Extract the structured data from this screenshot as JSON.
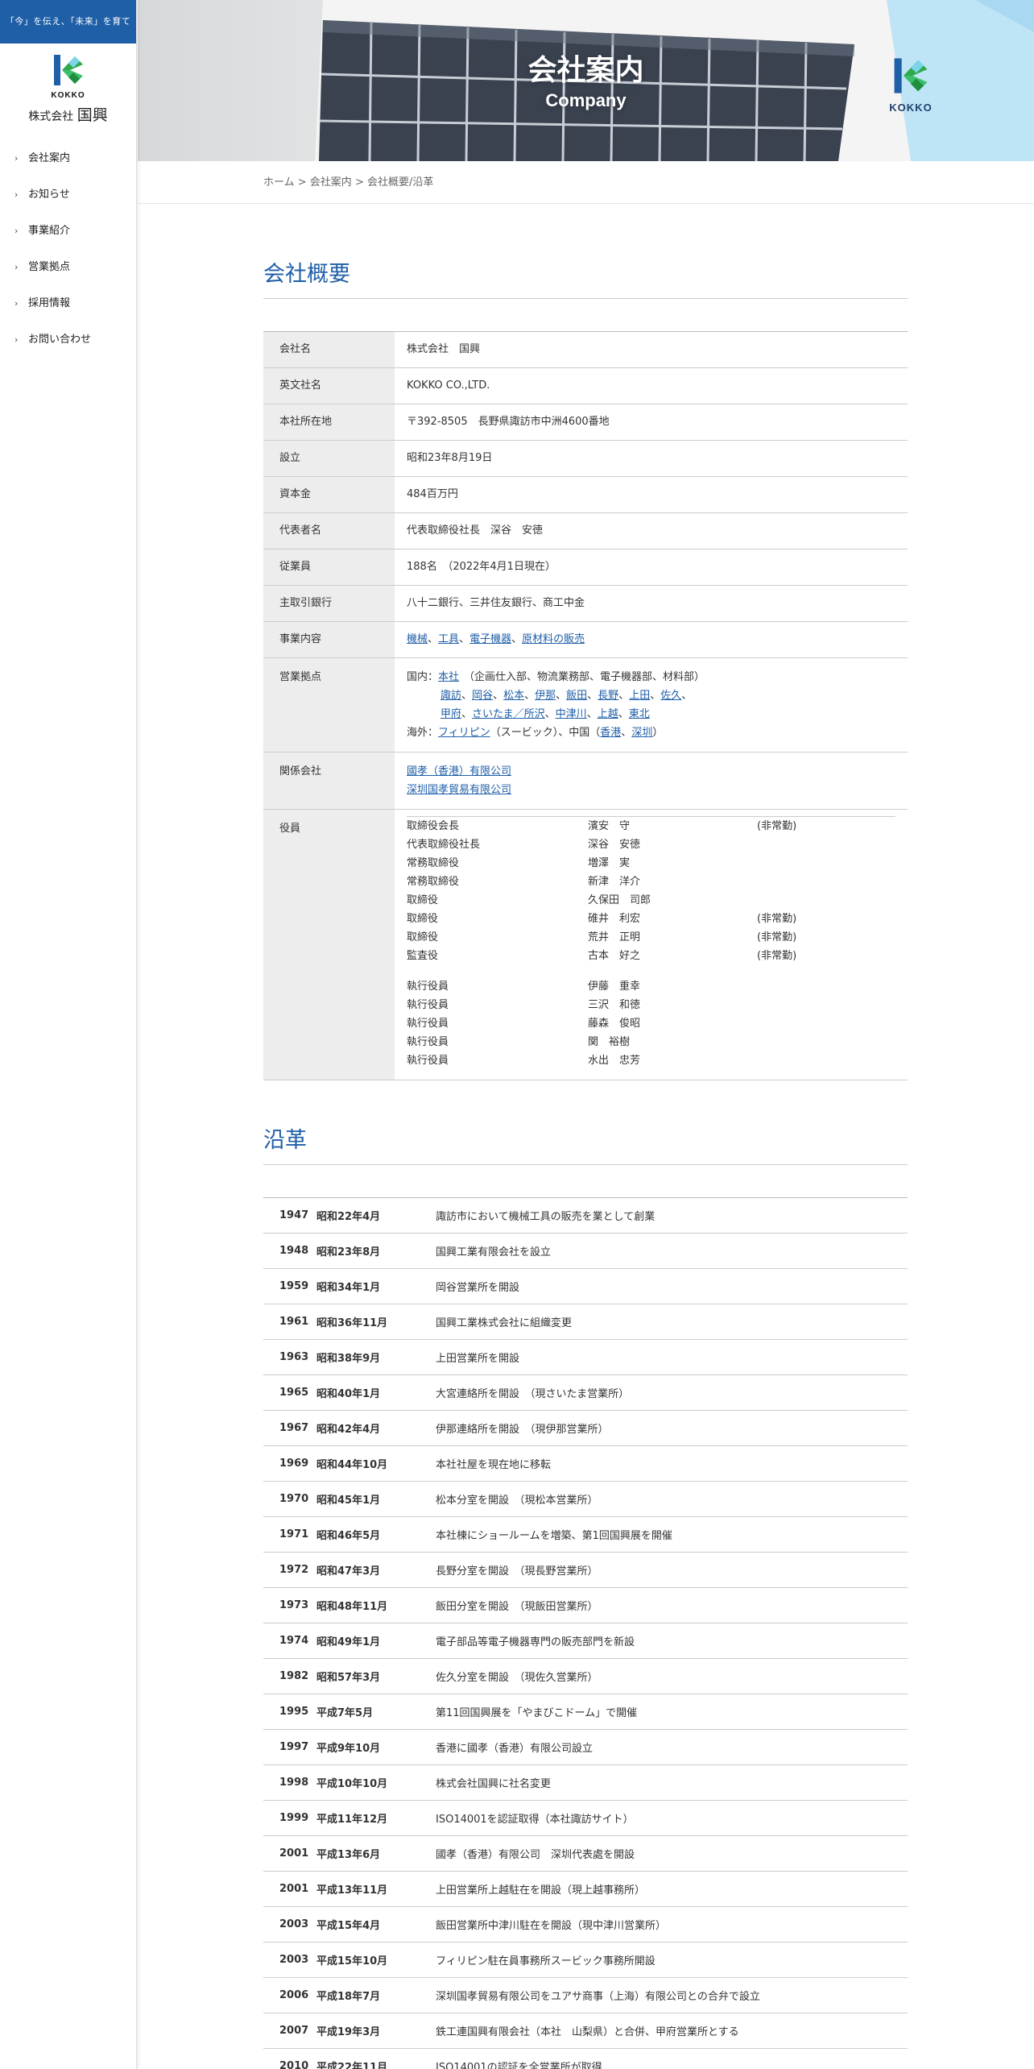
{
  "sidebar": {
    "tagline": "「今」を伝え、「未来」を育てる。",
    "logo_word": "KOKKO",
    "logo_company_prefix": "株式会社",
    "logo_company_name": "国興",
    "nav": [
      {
        "label": "会社案内"
      },
      {
        "label": "お知らせ"
      },
      {
        "label": "事業紹介"
      },
      {
        "label": "営業拠点"
      },
      {
        "label": "採用情報"
      },
      {
        "label": "お問い合わせ"
      }
    ]
  },
  "hero": {
    "title": "会社案内",
    "subtitle": "Company",
    "building_logo": "KOKKO"
  },
  "breadcrumb": {
    "home": "ホーム",
    "sep": " > ",
    "company": "会社案内",
    "current": "会社概要/沿革"
  },
  "overview": {
    "heading": "会社概要",
    "rows": {
      "name_k": "会社名",
      "name_v": "株式会社　国興",
      "en_k": "英文社名",
      "en_v": "KOKKO CO.,LTD.",
      "addr_k": "本社所在地",
      "addr_v": "〒392-8505　長野県諏訪市中洲4600番地",
      "est_k": "設立",
      "est_v": "昭和23年8月19日",
      "cap_k": "資本金",
      "cap_v": "484百万円",
      "rep_k": "代表者名",
      "rep_v": "代表取締役社長　深谷　安徳",
      "emp_k": "従業員",
      "emp_v": "188名　（2022年4月1日現在）",
      "bank_k": "主取引銀行",
      "bank_v": "八十二銀行、三井住友銀行、商工中金",
      "biz_k": "事業内容",
      "biz_links": [
        "機械",
        "工具",
        "電子機器",
        "原材料の販売"
      ],
      "sep_comma": "、",
      "office_k": "営業拠点",
      "office_dom_prefix": "国内：",
      "office_hq": "本社",
      "office_hq_note": "（企画仕入部、物流業務部、電子機器部、材料部）",
      "office_dom_line2": [
        "諏訪",
        "岡谷",
        "松本",
        "伊那",
        "飯田",
        "長野",
        "上田",
        "佐久"
      ],
      "office_dom_line3": [
        "甲府",
        "さいたま／所沢",
        "中津川",
        "上越",
        "東北"
      ],
      "office_ovs_prefix": "海外：",
      "office_ph": "フィリピン",
      "office_ph_note": "（スービック）、中国（",
      "office_hk": "香港",
      "office_sz": "深圳",
      "office_close": "）",
      "aff_k": "関係会社",
      "aff_links": [
        "國孝（香港）有限公司",
        "深圳国孝貿易有限公司"
      ],
      "off_k": "役員"
    },
    "officers": [
      {
        "title": "取締役会長",
        "name": "濱安　守",
        "note": "(非常勤)"
      },
      {
        "title": "代表取締役社長",
        "name": "深谷　安徳",
        "note": ""
      },
      {
        "title": "常務取締役",
        "name": "増澤　実",
        "note": ""
      },
      {
        "title": "常務取締役",
        "name": "新津　洋介",
        "note": ""
      },
      {
        "title": "取締役",
        "name": "久保田　司郎",
        "note": ""
      },
      {
        "title": "取締役",
        "name": "碓井　利宏",
        "note": "(非常勤)"
      },
      {
        "title": "取締役",
        "name": "荒井　正明",
        "note": "(非常勤)"
      },
      {
        "title": "監査役",
        "name": "古本　好之",
        "note": "(非常勤)"
      }
    ],
    "executives": [
      {
        "title": "執行役員",
        "name": "伊藤　重幸"
      },
      {
        "title": "執行役員",
        "name": "三沢　和徳"
      },
      {
        "title": "執行役員",
        "name": "藤森　俊昭"
      },
      {
        "title": "執行役員",
        "name": "関　裕樹"
      },
      {
        "title": "執行役員",
        "name": "水出　忠芳"
      }
    ]
  },
  "history": {
    "heading": "沿革",
    "rows": [
      {
        "year": "1947",
        "jp": "昭和22年4月",
        "event": "諏訪市において機械工具の販売を業として創業"
      },
      {
        "year": "1948",
        "jp": "昭和23年8月",
        "event": "国興工業有限会社を設立"
      },
      {
        "year": "1959",
        "jp": "昭和34年1月",
        "event": "岡谷営業所を開設"
      },
      {
        "year": "1961",
        "jp": "昭和36年11月",
        "event": "国興工業株式会社に組織変更"
      },
      {
        "year": "1963",
        "jp": "昭和38年9月",
        "event": "上田営業所を開設"
      },
      {
        "year": "1965",
        "jp": "昭和40年1月",
        "event": "大宮連絡所を開設　（現さいたま営業所）"
      },
      {
        "year": "1967",
        "jp": "昭和42年4月",
        "event": "伊那連絡所を開設　（現伊那営業所）"
      },
      {
        "year": "1969",
        "jp": "昭和44年10月",
        "event": "本社社屋を現在地に移転"
      },
      {
        "year": "1970",
        "jp": "昭和45年1月",
        "event": "松本分室を開設　（現松本営業所）"
      },
      {
        "year": "1971",
        "jp": "昭和46年5月",
        "event": "本社棟にショールームを増築、第1回国興展を開催"
      },
      {
        "year": "1972",
        "jp": "昭和47年3月",
        "event": "長野分室を開設　（現長野営業所）"
      },
      {
        "year": "1973",
        "jp": "昭和48年11月",
        "event": "飯田分室を開設　（現飯田営業所）"
      },
      {
        "year": "1974",
        "jp": "昭和49年1月",
        "event": "電子部品等電子機器専門の販売部門を新設"
      },
      {
        "year": "1982",
        "jp": "昭和57年3月",
        "event": "佐久分室を開設　（現佐久営業所）"
      },
      {
        "year": "1995",
        "jp": "平成7年5月",
        "event": "第11回国興展を「やまびこドーム」で開催"
      },
      {
        "year": "1997",
        "jp": "平成9年10月",
        "event": "香港に國孝（香港）有限公司設立"
      },
      {
        "year": "1998",
        "jp": "平成10年10月",
        "event": "株式会社国興に社名変更"
      },
      {
        "year": "1999",
        "jp": "平成11年12月",
        "event": "ISO14001を認証取得（本社諏訪サイト）"
      },
      {
        "year": "2001",
        "jp": "平成13年6月",
        "event": "國孝（香港）有限公司　深圳代表處を開設"
      },
      {
        "year": "2001",
        "jp": "平成13年11月",
        "event": "上田営業所上越駐在を開設（現上越事務所）"
      },
      {
        "year": "2003",
        "jp": "平成15年4月",
        "event": "飯田営業所中津川駐在を開設（現中津川営業所）"
      },
      {
        "year": "2003",
        "jp": "平成15年10月",
        "event": "フィリピン駐在員事務所スービック事務所開設"
      },
      {
        "year": "2006",
        "jp": "平成18年7月",
        "event": "深圳国孝貿易有限公司をユアサ商事（上海）有限公司との合弁で設立"
      },
      {
        "year": "2007",
        "jp": "平成19年3月",
        "event": "鉄工連国興有限会社（本社　山梨県）と合併、甲府営業所とする"
      },
      {
        "year": "2010",
        "jp": "平成22年11月",
        "event": "ISO14001の認証を全営業所が取得"
      }
    ]
  }
}
